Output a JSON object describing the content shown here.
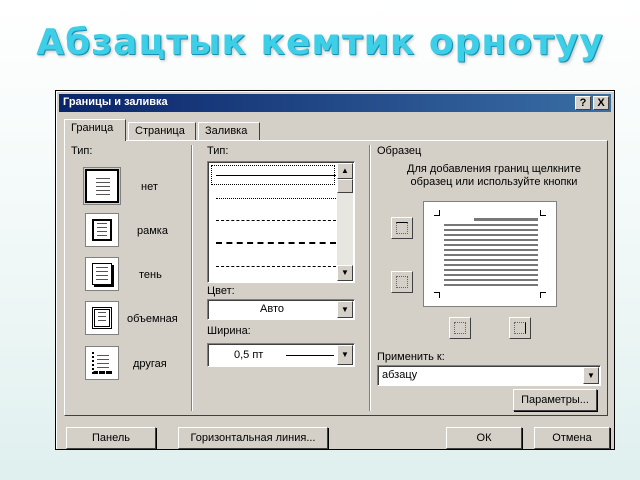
{
  "slide": {
    "title": "Абзацтык кемтик орнотуу"
  },
  "dialog": {
    "title": "Границы и заливка",
    "help": "?",
    "close": "X",
    "tabs": [
      {
        "label": "Граница",
        "active": true
      },
      {
        "label": "Страница",
        "active": false
      },
      {
        "label": "Заливка",
        "active": false
      }
    ],
    "setting": {
      "label": "Тип:",
      "presets": [
        {
          "label": "нет",
          "selected": true,
          "icon": "no-border-icon"
        },
        {
          "label": "рамка",
          "selected": false,
          "icon": "box-border-icon"
        },
        {
          "label": "тень",
          "selected": false,
          "icon": "shadow-border-icon"
        },
        {
          "label": "объемная",
          "selected": false,
          "icon": "3d-border-icon"
        },
        {
          "label": "другая",
          "selected": false,
          "icon": "custom-border-icon"
        }
      ]
    },
    "style": {
      "label": "Тип:",
      "color_label": "Цвет:",
      "color_value": "Авто",
      "width_label": "Ширина:",
      "width_value": "0,5 пт"
    },
    "preview": {
      "label": "Образец",
      "hint": "Для добавления границ щелкните образец или используйте кнопки"
    },
    "apply_to": {
      "label": "Применить к:",
      "value": "абзацу"
    },
    "buttons": {
      "options": "Параметры...",
      "toolbar": "Панель",
      "horizontal_line": "Горизонтальная линия...",
      "ok": "ОК",
      "cancel": "Отмена"
    }
  }
}
